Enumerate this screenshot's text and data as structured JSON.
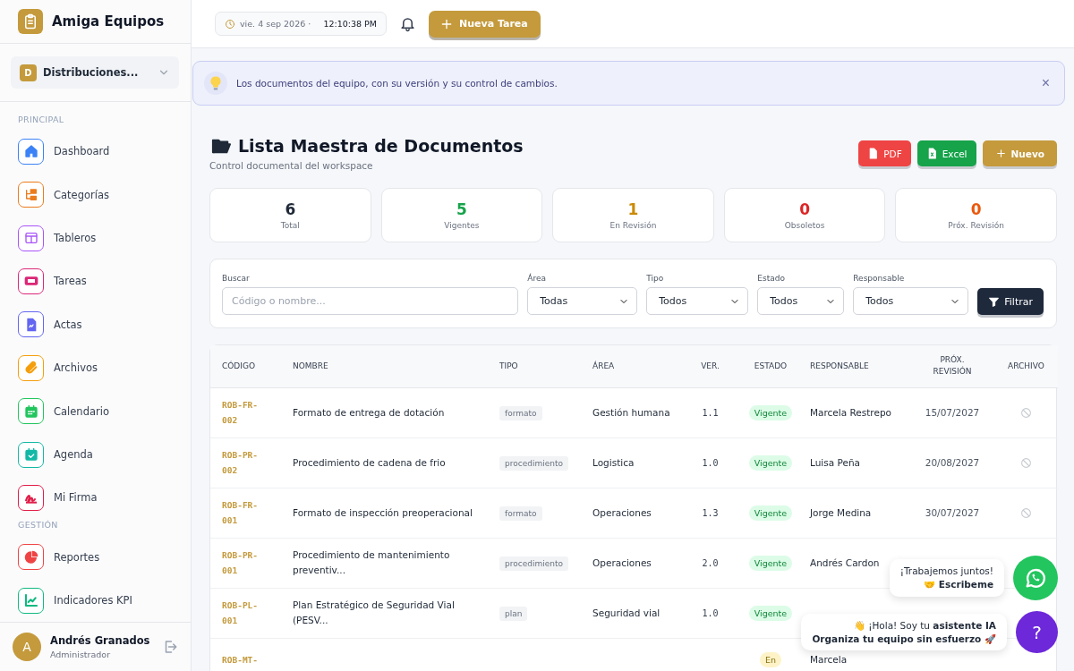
{
  "brand": {
    "name": "Amiga Equipos"
  },
  "workspace": {
    "initial": "D",
    "name": "Distribuciones..."
  },
  "sidebar": {
    "sections": [
      {
        "title": "PRINCIPAL",
        "items": [
          {
            "label": "Dashboard",
            "color": "#3b82f6"
          },
          {
            "label": "Categorías",
            "color": "#ea7c1c"
          },
          {
            "label": "Tableros",
            "color": "#a855f7"
          },
          {
            "label": "Tareas",
            "color": "#db2777"
          },
          {
            "label": "Actas",
            "color": "#6366f1"
          },
          {
            "label": "Archivos",
            "color": "#f59e0b"
          },
          {
            "label": "Calendario",
            "color": "#22c55e"
          },
          {
            "label": "Agenda",
            "color": "#14b8a6"
          },
          {
            "label": "Mi Firma",
            "color": "#e11d48"
          }
        ]
      },
      {
        "title": "GESTIÓN",
        "items": [
          {
            "label": "Reportes",
            "color": "#ef4444"
          },
          {
            "label": "Indicadores KPI",
            "color": "#10b981"
          }
        ]
      }
    ]
  },
  "user": {
    "initial": "A",
    "name": "Andrés Granados",
    "role": "Administrador"
  },
  "topbar": {
    "date": "vie. 4 sep 2026 ·",
    "time": "12:10:38 PM",
    "new_task": "Nueva Tarea"
  },
  "banner": {
    "text": "Los documentos del equipo, con su versión y su control de cambios.",
    "close": "×"
  },
  "page": {
    "title": "Lista Maestra de Documentos",
    "subtitle": "Control documental del workspace",
    "actions": [
      {
        "label": "PDF",
        "kind": "pdf"
      },
      {
        "label": "Excel",
        "kind": "excel"
      },
      {
        "label": "Nuevo",
        "kind": "new"
      }
    ]
  },
  "stats": [
    {
      "value": "6",
      "label": "Total",
      "color": "#1f2937"
    },
    {
      "value": "5",
      "label": "Vigentes",
      "color": "#16a34a"
    },
    {
      "value": "1",
      "label": "En Revisión",
      "color": "#ca8a04"
    },
    {
      "value": "0",
      "label": "Obsoletos",
      "color": "#dc2626"
    },
    {
      "value": "0",
      "label": "Próx. Revisión",
      "color": "#ea580c"
    }
  ],
  "filters": {
    "search": {
      "label": "Buscar",
      "placeholder": "Código o nombre..."
    },
    "selects": [
      {
        "label": "Área",
        "value": "Todas"
      },
      {
        "label": "Tipo",
        "value": "Todos"
      },
      {
        "label": "Estado",
        "value": "Todos"
      },
      {
        "label": "Responsable",
        "value": "Todos"
      }
    ],
    "button": "Filtrar"
  },
  "table": {
    "columns": [
      "CÓDIGO",
      "NOMBRE",
      "TIPO",
      "ÁREA",
      "VER.",
      "ESTADO",
      "RESPONSABLE",
      "PRÓX. REVISIÓN",
      "ARCHIVO"
    ],
    "rows": [
      {
        "code": "ROB-FR-002",
        "name": "Formato de entrega de dotación",
        "type": "formato",
        "area": "Gestión humana",
        "version": "1.1",
        "status": "Vigente",
        "color": "#dcfce7",
        "owner": "Marcela Restrepo",
        "next_review": "15/07/2027"
      },
      {
        "code": "ROB-PR-002",
        "name": "Procedimiento de cadena de frio",
        "type": "procedimiento",
        "area": "Logistica",
        "version": "1.0",
        "status": "Vigente",
        "color": "#dcfce7",
        "owner": "Luisa Peña",
        "next_review": "20/08/2027"
      },
      {
        "code": "ROB-FR-001",
        "name": "Formato de inspección preoperacional",
        "type": "formato",
        "area": "Operaciones",
        "version": "1.3",
        "status": "Vigente",
        "color": "#dcfce7",
        "owner": "Jorge Medina",
        "next_review": "30/07/2027"
      },
      {
        "code": "ROB-PR-001",
        "name": "Procedimiento de mantenimiento preventiv...",
        "type": "procedimiento",
        "area": "Operaciones",
        "version": "2.0",
        "status": "Vigente",
        "color": "#dcfce7",
        "owner": "Andrés Cardon"
      },
      {
        "code": "ROB-PL-001",
        "name": "Plan Estratégico de Seguridad Vial (PESV...",
        "type": "plan",
        "area": "Seguridad vial",
        "version": "1.0",
        "status": "Vigente",
        "color": "#dcfce7"
      },
      {
        "code": "ROB-MT-",
        "status": "En",
        "color": "#fef3c7",
        "owner": "Marcela"
      }
    ]
  },
  "chat_bubbles": [
    {
      "kind": "whatsapp",
      "line1": "¡Trabajemos juntos!",
      "line2": "🤝 Escribeme"
    },
    {
      "kind": "assistant",
      "line1": "👋 ¡Hola! Soy tu **asistente IA**",
      "line2": "Organiza tu equipo sin esfuerzo 🚀",
      "button": "?"
    }
  ]
}
